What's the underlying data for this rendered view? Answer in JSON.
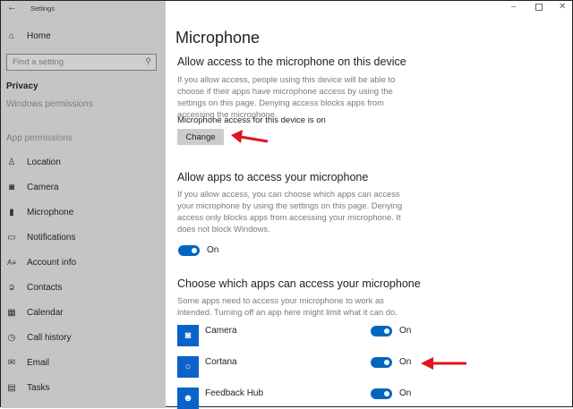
{
  "window": {
    "title": "Settings",
    "back_icon": "arrow-left-icon",
    "controls": [
      "minimize-icon",
      "maximize-icon",
      "close-icon"
    ]
  },
  "sidebar": {
    "home": "Home",
    "search_placeholder": "Find a setting",
    "section": "Privacy",
    "windows_permissions": "Windows permissions",
    "app_permissions": "App permissions",
    "items": [
      {
        "label": "Location",
        "icon": "location-icon"
      },
      {
        "label": "Camera",
        "icon": "camera-icon"
      },
      {
        "label": "Microphone",
        "icon": "microphone-icon"
      },
      {
        "label": "Notifications",
        "icon": "notifications-icon"
      },
      {
        "label": "Account info",
        "icon": "account-info-icon"
      },
      {
        "label": "Contacts",
        "icon": "contacts-icon"
      },
      {
        "label": "Calendar",
        "icon": "calendar-icon"
      },
      {
        "label": "Call history",
        "icon": "call-history-icon"
      },
      {
        "label": "Email",
        "icon": "email-icon"
      },
      {
        "label": "Tasks",
        "icon": "tasks-icon"
      }
    ]
  },
  "main": {
    "title": "Microphone",
    "device": {
      "heading": "Allow access to the microphone on this device",
      "description": "If you allow access, people using this device will be able to choose if their apps have microphone access by using the settings on this page. Denying access blocks apps from accessing the microphone.",
      "status": "Microphone access for this device is on",
      "button": "Change"
    },
    "apps_access": {
      "heading": "Allow apps to access your microphone",
      "description": "If you allow access, you can choose which apps can access your microphone by using the settings on this page. Denying access only blocks apps from accessing your microphone. It does not block Windows.",
      "toggle_label": "On",
      "toggle_on": true
    },
    "choose": {
      "heading": "Choose which apps can access your microphone",
      "description": "Some apps need to access your microphone to work as intended. Turning off an app here might limit what it can do.",
      "apps": [
        {
          "name": "Camera",
          "state": "On",
          "on": true,
          "icon": "camera-app-icon"
        },
        {
          "name": "Cortana",
          "state": "On",
          "on": true,
          "icon": "cortana-icon"
        },
        {
          "name": "Feedback Hub",
          "state": "On",
          "on": true,
          "icon": "feedback-hub-icon"
        }
      ]
    }
  },
  "colors": {
    "accent": "#0067c0",
    "annotation_arrow": "#e0141e",
    "sidebar": "#c5c5c5"
  }
}
